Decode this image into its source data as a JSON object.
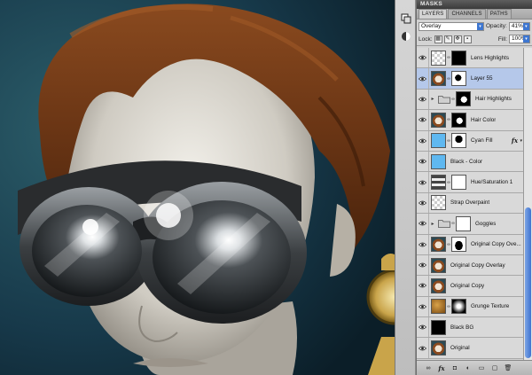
{
  "panel": {
    "masks_label": "MASKS",
    "tabs": [
      {
        "label": "LAYERS",
        "active": true
      },
      {
        "label": "CHANNELS",
        "active": false
      },
      {
        "label": "PATHS",
        "active": false
      }
    ],
    "blend_mode": "Overlay",
    "opacity_label": "Opacity:",
    "opacity_value": "41%",
    "lock_label": "Lock:",
    "fill_label": "Fill:",
    "fill_value": "100%"
  },
  "layers": [
    {
      "name": "Lens Highlights",
      "thumb": "checker",
      "mask": "black-small",
      "chain": true
    },
    {
      "name": "Layer 55",
      "thumb": "face",
      "mask": "hair-white",
      "chain": true,
      "selected": true
    },
    {
      "name": "Hair Highlights",
      "thumb": "folder",
      "mask": "hair-black",
      "chain": true,
      "group": true
    },
    {
      "name": "Hair Color",
      "thumb": "face",
      "mask": "hair-black",
      "chain": true
    },
    {
      "name": "Cyan Fill",
      "thumb": "cyan",
      "mask": "silhouette",
      "chain": true,
      "fx": true
    },
    {
      "name": "Black - Color",
      "thumb": "cyan-fill",
      "mask": null,
      "chain": false
    },
    {
      "name": "Hue/Saturation 1",
      "thumb": "adjust",
      "mask": "small-mark",
      "chain": true
    },
    {
      "name": "Strap Overpaint",
      "thumb": "checker",
      "mask": null,
      "chain": false
    },
    {
      "name": "Goggles",
      "thumb": "folder",
      "mask": "small-mark",
      "chain": true,
      "group": true
    },
    {
      "name": "Original Copy Ove...",
      "thumb": "face",
      "mask": "black-figure",
      "chain": true
    },
    {
      "name": "Original Copy Overlay",
      "thumb": "face",
      "mask": null,
      "chain": false
    },
    {
      "name": "Original Copy",
      "thumb": "face",
      "mask": null,
      "chain": false
    },
    {
      "name": "Grunge Texture",
      "thumb": "grunge",
      "mask": "radial",
      "chain": true
    },
    {
      "name": "Black BG",
      "thumb": "black",
      "mask": null,
      "chain": false
    },
    {
      "name": "Original",
      "thumb": "face",
      "mask": null,
      "chain": false
    }
  ],
  "bottom_icons": [
    "link-icon",
    "fx-icon",
    "mask-icon",
    "adjustment-icon",
    "group-icon",
    "new-layer-icon",
    "trash-icon"
  ],
  "bottom_glyphs": [
    "∞",
    "fx",
    "◘",
    "◐",
    "▭",
    "▢",
    "🗑"
  ],
  "colors": {
    "selected_row": "#b5c8ea",
    "scroll_accent": "#3d72cf",
    "cyan_fill": "#5fb8f0"
  }
}
